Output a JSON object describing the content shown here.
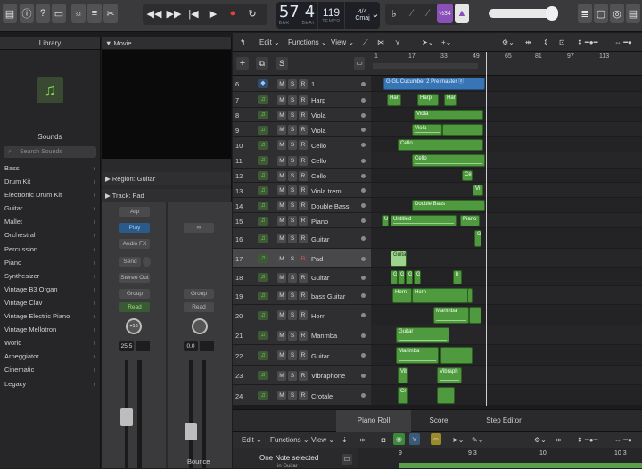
{
  "lcd": {
    "bar": "57",
    "beat": "4",
    "bar_label": "BAR",
    "beat_label": "BEAT",
    "tempo": "119",
    "tempo_label": "TEMPO",
    "signature": "4/4",
    "key": "Cmaj"
  },
  "toolbar": {
    "tuner_badge": "½34"
  },
  "library": {
    "title": "Library",
    "sounds_label": "Sounds",
    "search_placeholder": "Search Sounds",
    "items": [
      "Bass",
      "Drum Kit",
      "Electronic Drum Kit",
      "Guitar",
      "Mallet",
      "Orchestral",
      "Percussion",
      "Piano",
      "Synthesizer",
      "Vintage B3 Organ",
      "Vintage Clav",
      "Vintage Electric Piano",
      "Vintage Mellotron",
      "World",
      "Arpeggiator",
      "Cinematic",
      "Legacy"
    ]
  },
  "inspector": {
    "movie": "Movie",
    "region": "Region: Guitar",
    "track": "Track: Pad",
    "strip_left": {
      "arp": "Arp",
      "play": "Play",
      "audio_fx": "Audio FX",
      "send": "Send",
      "output": "Stereo Out",
      "group": "Group",
      "read": "Read",
      "pan": "+16",
      "gain": "25.5"
    },
    "strip_right": {
      "link": "∞",
      "group": "Group",
      "read": "Read",
      "gain": "0.0",
      "name": "Bounce"
    }
  },
  "tracks_toolbar": {
    "edit": "Edit",
    "functions": "Functions",
    "view": "View"
  },
  "ruler": {
    "ticks": [
      "1",
      "17",
      "33",
      "49",
      "65",
      "81",
      "97",
      "113"
    ]
  },
  "tracks": [
    {
      "num": "6",
      "name": "1",
      "icon": "blue"
    },
    {
      "num": "7",
      "name": "Harp"
    },
    {
      "num": "8",
      "name": "Viola"
    },
    {
      "num": "9",
      "name": "Viola"
    },
    {
      "num": "10",
      "name": "Cello"
    },
    {
      "num": "11",
      "name": "Cello"
    },
    {
      "num": "12",
      "name": "Cello"
    },
    {
      "num": "13",
      "name": "Viola trem"
    },
    {
      "num": "14",
      "name": "Double Bass"
    },
    {
      "num": "15",
      "name": "Piano"
    },
    {
      "num": "16",
      "name": "Guitar"
    },
    {
      "num": "17",
      "name": "Pad",
      "selected": true
    },
    {
      "num": "18",
      "name": "Guitar"
    },
    {
      "num": "19",
      "name": "bass Guitar"
    },
    {
      "num": "20",
      "name": "Horn"
    },
    {
      "num": "21",
      "name": "Marimba"
    },
    {
      "num": "22",
      "name": "Guitar"
    },
    {
      "num": "23",
      "name": "Vibraphone"
    },
    {
      "num": "24",
      "name": "Crotale"
    }
  ],
  "regions": {
    "cucumber": "GIGL Cucumber 2 Pre master  ⓞ",
    "harp1": "Har",
    "harp2": "Harp",
    "harp3": "Har",
    "viola1": "Viola",
    "viola2": "Viola",
    "cello1": "Cello",
    "cello2": "Cello",
    "cello3": "Ce",
    "vi": "Vi",
    "double_bass": "Double Bass",
    "piano_u": "U",
    "untitled": "Untitled",
    "piano": "Piano",
    "guitar16": "G",
    "pad": "Guita",
    "bass_g": "G",
    "bass_b": "b",
    "horn1": "Horn",
    "horn2": "Horn",
    "marimba1": "Marimba",
    "guitar22": "Guitar",
    "marimba2": "Marimba",
    "vib": "Vib",
    "vibraph": "Vibraph",
    "crotale": "Cr"
  },
  "piano_roll": {
    "tabs": [
      "Piano Roll",
      "Score",
      "Step Editor"
    ],
    "edit": "Edit",
    "functions": "Functions",
    "view": "View",
    "status": "One Note selected",
    "status_sub": "in Guitar",
    "ruler_ticks": [
      "9",
      "9 3",
      "10",
      "10 3"
    ]
  }
}
